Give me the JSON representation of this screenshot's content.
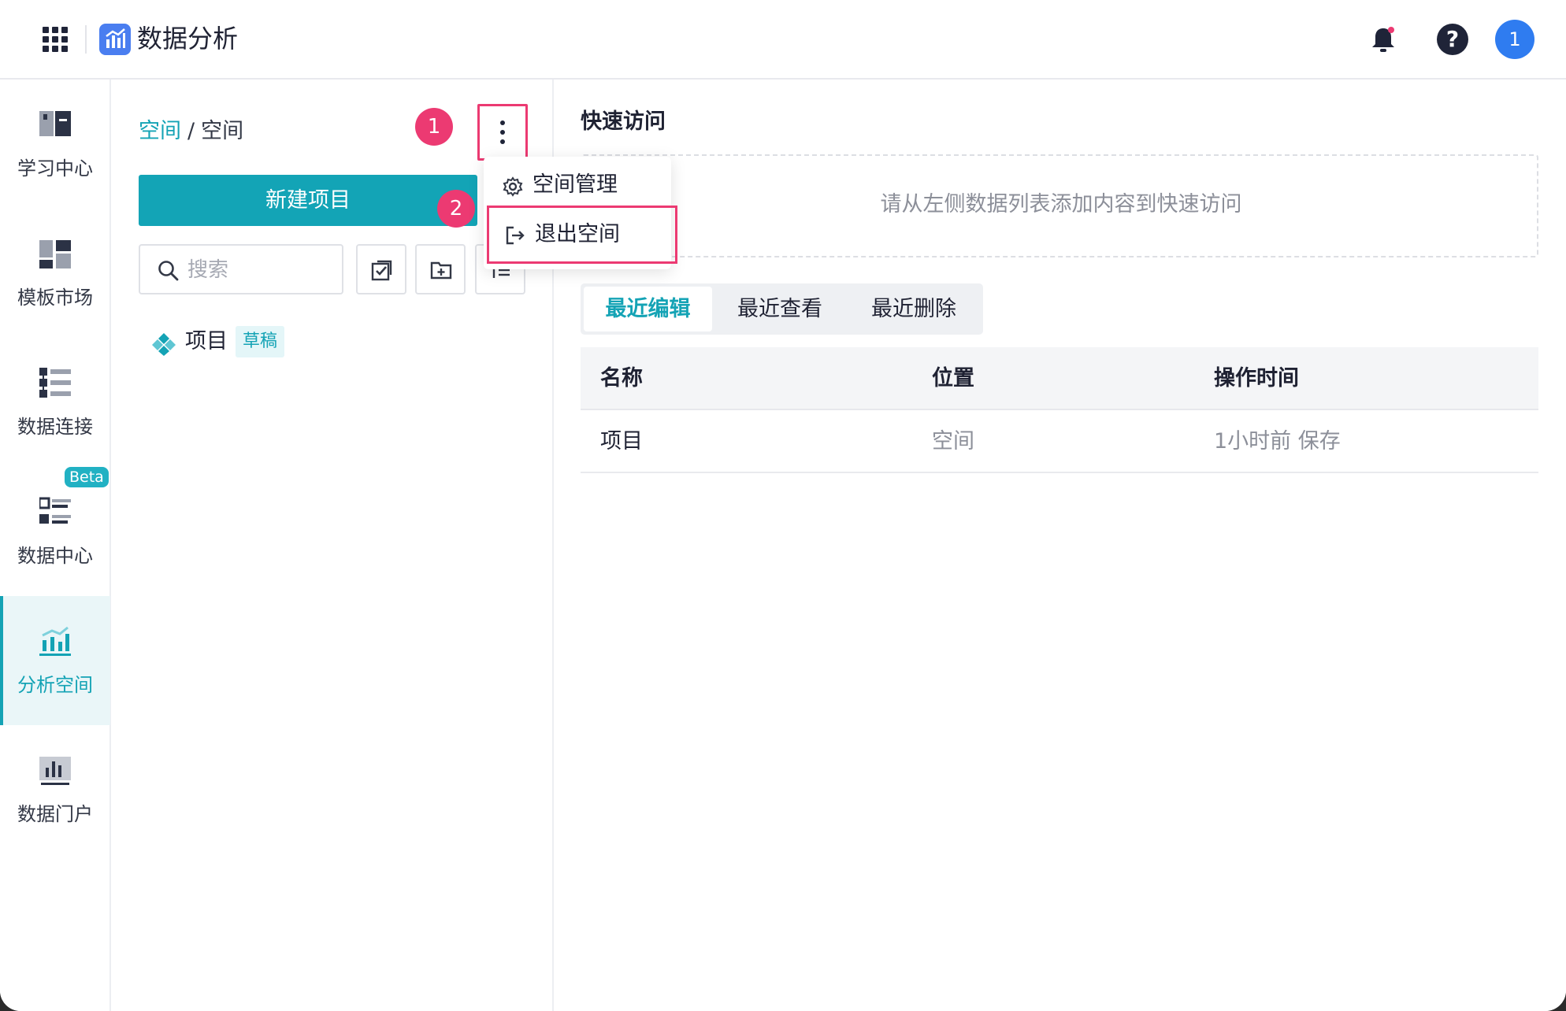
{
  "header": {
    "app_title": "数据分析",
    "apps_icon": "grid-icon",
    "notification_icon": "bell-icon",
    "help_icon": "question-icon",
    "help_glyph": "?",
    "avatar_text": "1",
    "accent_color": "#14a3b5"
  },
  "sidenav": {
    "items": [
      {
        "label": "学习中心",
        "icon": "book-icon"
      },
      {
        "label": "模板市场",
        "icon": "template-icon"
      },
      {
        "label": "数据连接",
        "icon": "data-connect-icon"
      },
      {
        "label": "数据中心",
        "icon": "data-center-icon",
        "badge": "Beta"
      },
      {
        "label": "分析空间",
        "icon": "analysis-icon",
        "active": true
      },
      {
        "label": "数据门户",
        "icon": "portal-icon"
      }
    ]
  },
  "leftpanel": {
    "breadcrumb": {
      "link": "空间",
      "separator": "/",
      "current": "空间"
    },
    "step1": "1",
    "step2": "2",
    "new_button": "新建项目",
    "search_placeholder": "搜索",
    "tree": [
      {
        "label": "项目",
        "badge": "草稿"
      }
    ]
  },
  "dropdown": {
    "items": [
      {
        "label": "空间管理",
        "icon": "gear-icon"
      },
      {
        "label": "退出空间",
        "icon": "logout-icon",
        "highlighted": true
      }
    ]
  },
  "main": {
    "quick_title": "快速访问",
    "quick_hint": "请从左侧数据列表添加内容到快速访问",
    "tabs": [
      {
        "label": "最近编辑",
        "active": true
      },
      {
        "label": "最近查看"
      },
      {
        "label": "最近删除"
      }
    ],
    "table": {
      "columns": [
        "名称",
        "位置",
        "操作时间"
      ],
      "rows": [
        [
          "项目",
          "空间",
          "1小时前 保存"
        ]
      ]
    }
  },
  "annotation_color": "#ec3a72"
}
